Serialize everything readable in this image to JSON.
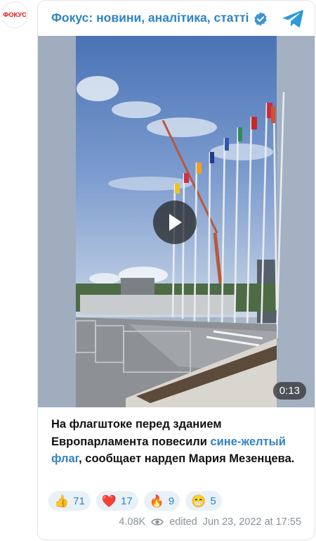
{
  "avatar": {
    "text": "ФОКУС",
    "color": "#e2191a"
  },
  "header": {
    "channel_title": "Фокус: новини, аналітика, статті",
    "verified_icon": "verified-badge-icon",
    "telegram_icon": "telegram-icon",
    "accent": "#2f83c4"
  },
  "media": {
    "type": "video",
    "duration": "0:13",
    "play_icon": "play-icon"
  },
  "post": {
    "text_before": "На флагштоке перед зданием Европарламента повесили ",
    "link_text": "сине-желтый флаг",
    "text_after": ", сообщает нардеп Мария Мезенцева."
  },
  "reactions": [
    {
      "emoji": "👍",
      "count": "71"
    },
    {
      "emoji": "❤️",
      "count": "17"
    },
    {
      "emoji": "🔥",
      "count": "9"
    },
    {
      "emoji": "😁",
      "count": "5"
    }
  ],
  "meta": {
    "views": "4.08K",
    "eye_icon": "eye-icon",
    "edited_label": "edited",
    "date": "Jun 23, 2022 at 17:55"
  }
}
